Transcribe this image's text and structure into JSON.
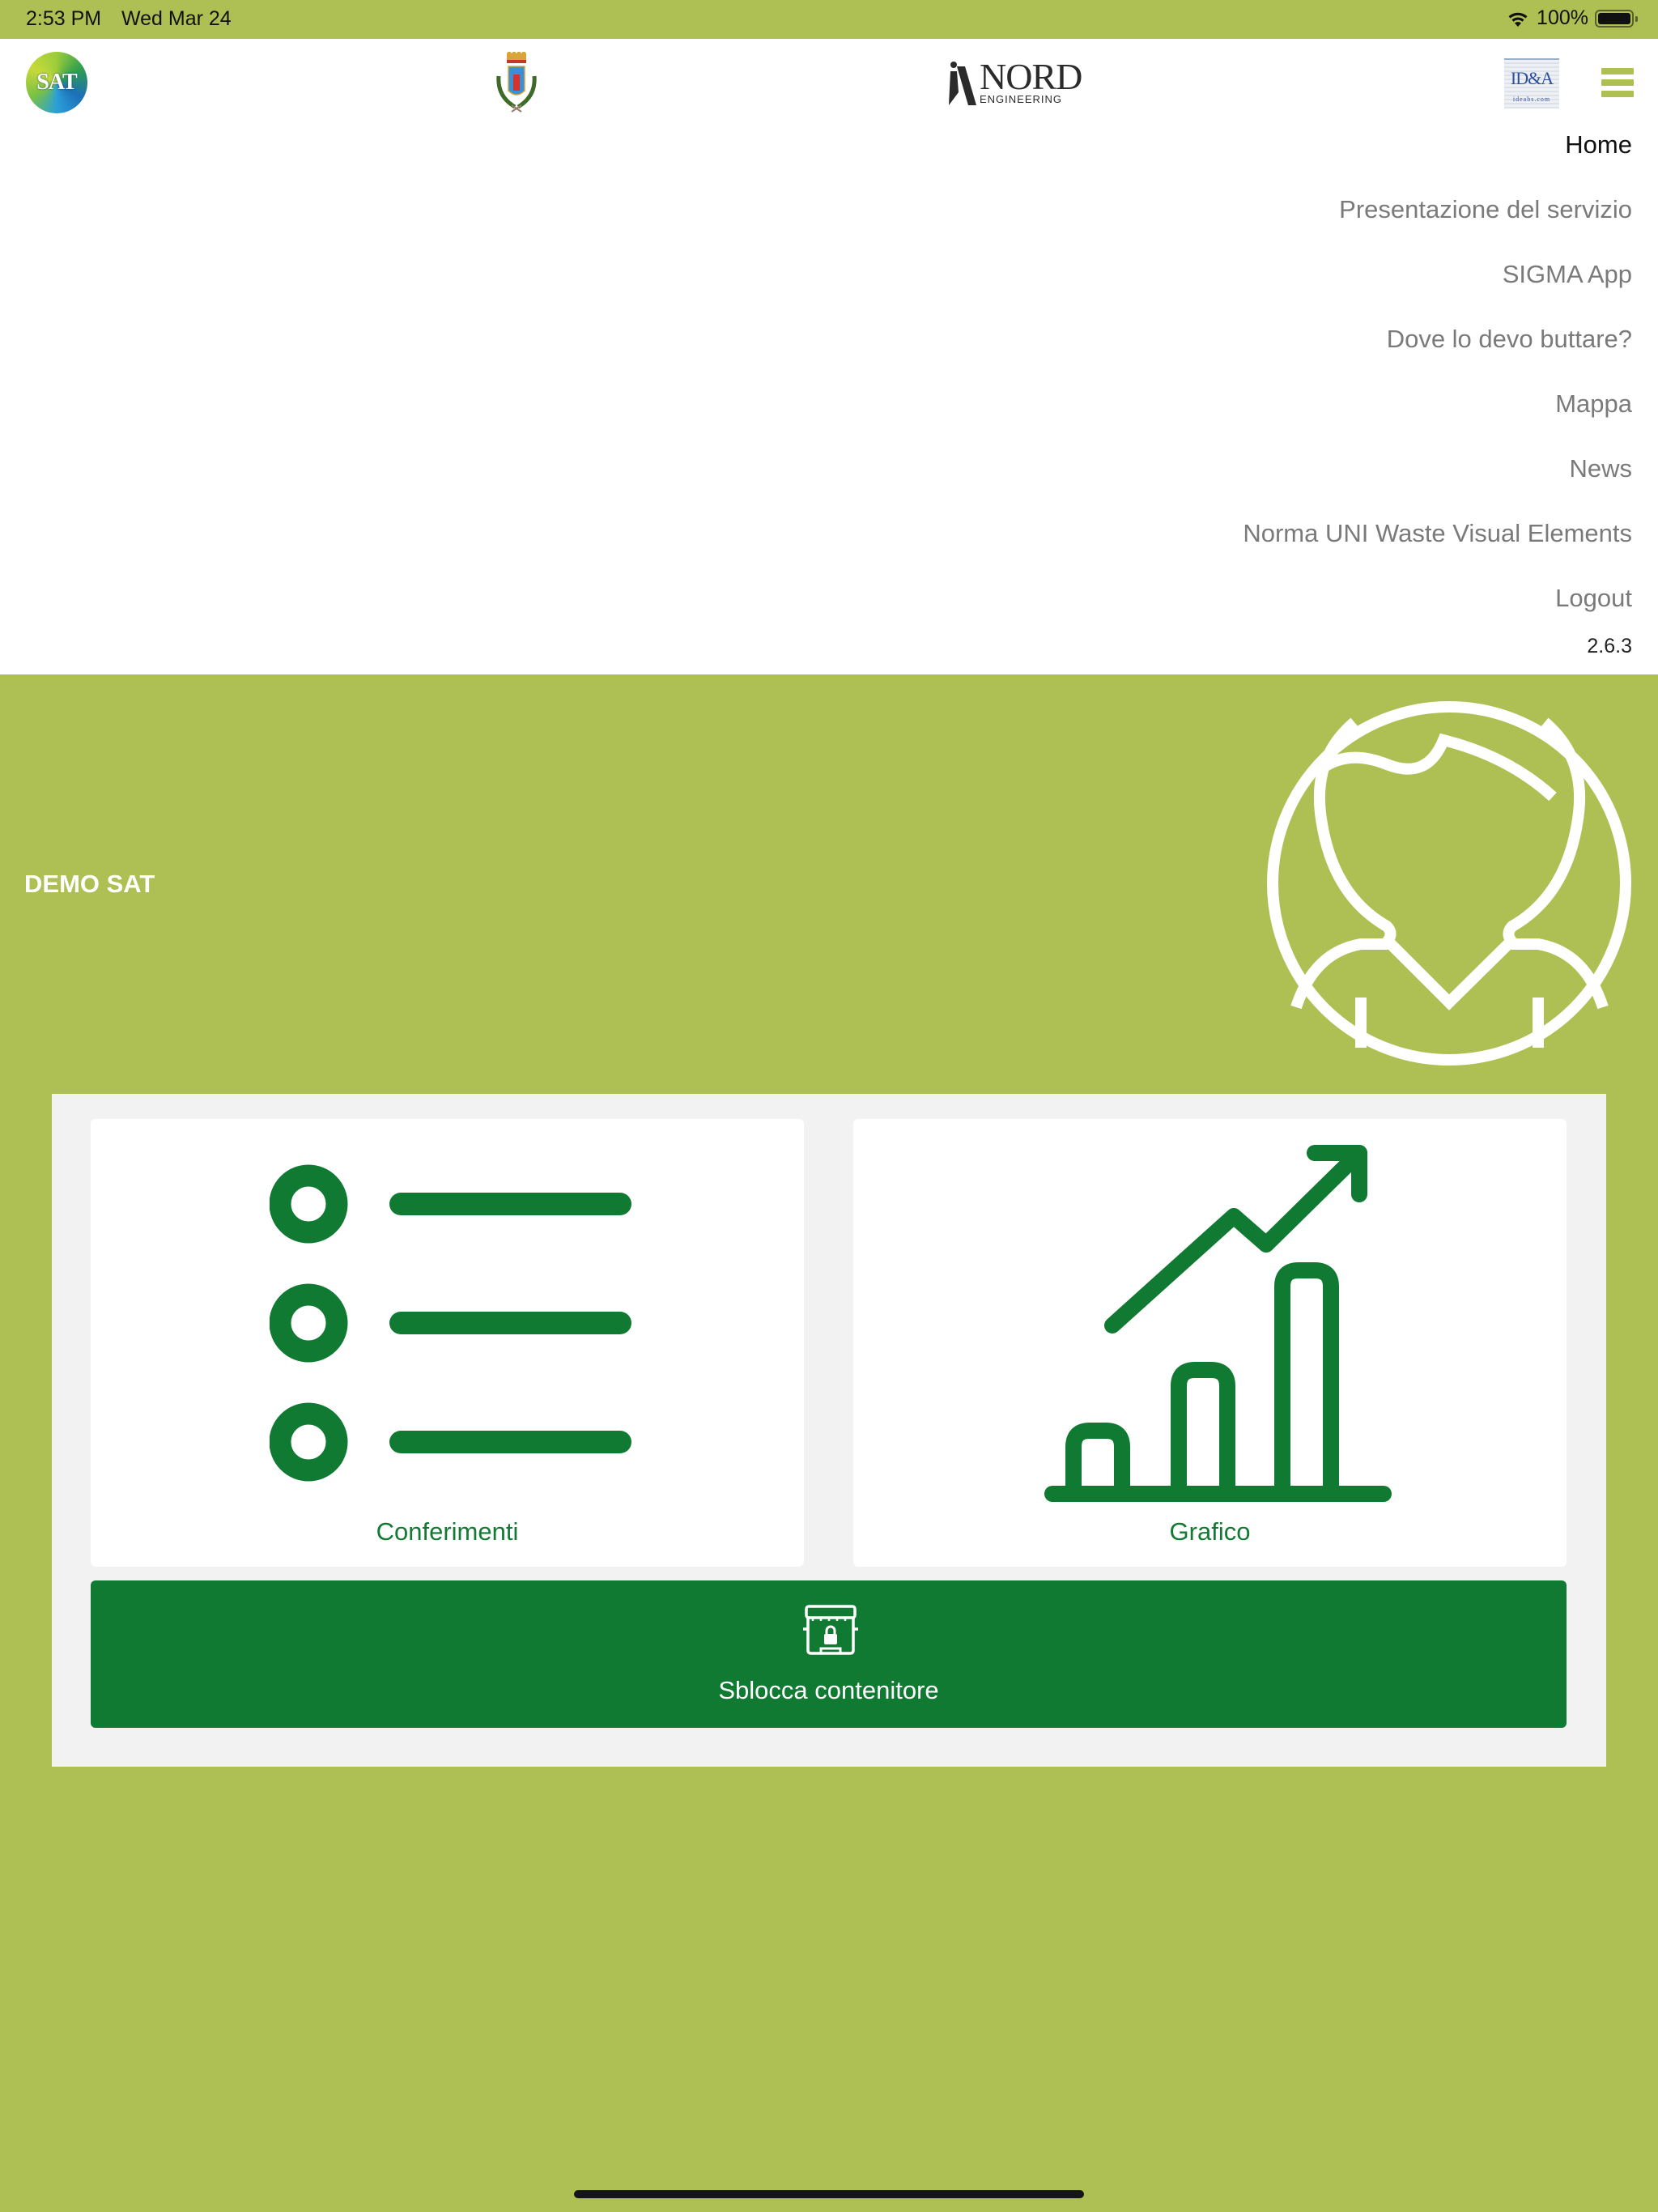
{
  "status_bar": {
    "time": "2:53 PM",
    "date": "Wed Mar 24",
    "battery_percent": "100%",
    "battery_level": 1.0,
    "wifi_icon": "wifi-icon",
    "battery_icon": "battery-icon"
  },
  "header": {
    "logos": {
      "sat": "SAT",
      "nord_main": "NORD",
      "nord_sub": "ENGINEERING",
      "idea_main": "ID&A",
      "idea_sub": "ideabs.com"
    },
    "menu_icon": "hamburger-menu-icon"
  },
  "menu": {
    "items": [
      {
        "label": "Home",
        "active": true
      },
      {
        "label": "Presentazione del servizio",
        "active": false
      },
      {
        "label": "SIGMA App",
        "active": false
      },
      {
        "label": "Dove lo devo buttare?",
        "active": false
      },
      {
        "label": "Mappa",
        "active": false
      },
      {
        "label": "News",
        "active": false
      },
      {
        "label": "Norma UNI Waste Visual Elements",
        "active": false
      },
      {
        "label": "Logout",
        "active": false
      }
    ],
    "version": "2.6.3"
  },
  "profile": {
    "name": "DEMO SAT",
    "avatar_icon": "user-avatar-icon"
  },
  "dashboard": {
    "cards": [
      {
        "label": "Conferimenti",
        "icon": "list-icon"
      },
      {
        "label": "Grafico",
        "icon": "bar-chart-growth-icon"
      }
    ],
    "unlock_button": {
      "label": "Sblocca contenitore",
      "icon": "locked-bin-icon"
    }
  },
  "colors": {
    "brand_light_green": "#aec053",
    "brand_dark_green": "#107a33",
    "panel_gray": "#f2f2f2",
    "menu_text": "#7a7a7a"
  }
}
